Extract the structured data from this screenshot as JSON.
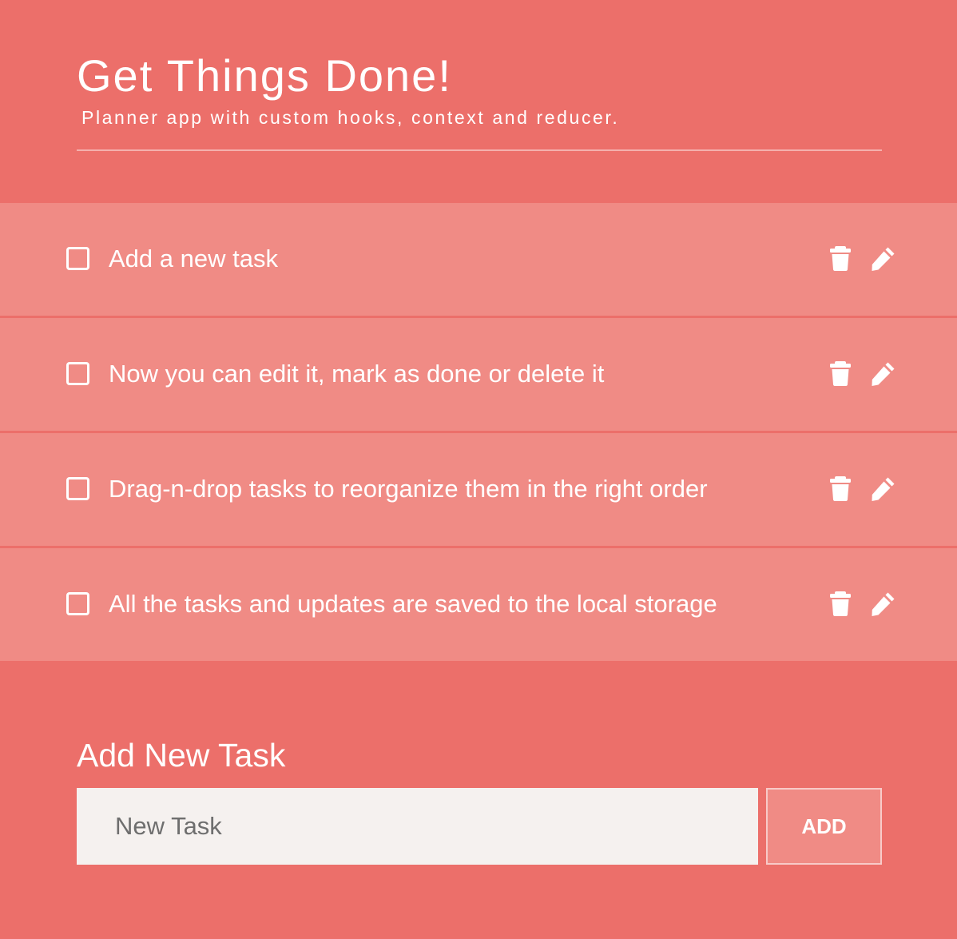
{
  "header": {
    "title": "Get Things Done!",
    "subtitle": "Planner app with custom hooks, context and reducer."
  },
  "tasks": [
    {
      "text": "Add a new task",
      "done": false
    },
    {
      "text": "Now you can edit it, mark as done or delete it",
      "done": false
    },
    {
      "text": "Drag-n-drop tasks to reorganize them in the right order",
      "done": false
    },
    {
      "text": "All the tasks and updates are saved to the local storage",
      "done": false
    }
  ],
  "add_form": {
    "heading": "Add New Task",
    "input_placeholder": "New Task",
    "input_value": "",
    "button_label": "ADD"
  },
  "icons": {
    "delete": "trash-icon",
    "edit": "pencil-icon",
    "checkbox": "checkbox-icon"
  },
  "colors": {
    "background": "#ec6f6a",
    "task_row": "#f08b85",
    "input_background": "#f5f1ef",
    "text": "#ffffff"
  }
}
